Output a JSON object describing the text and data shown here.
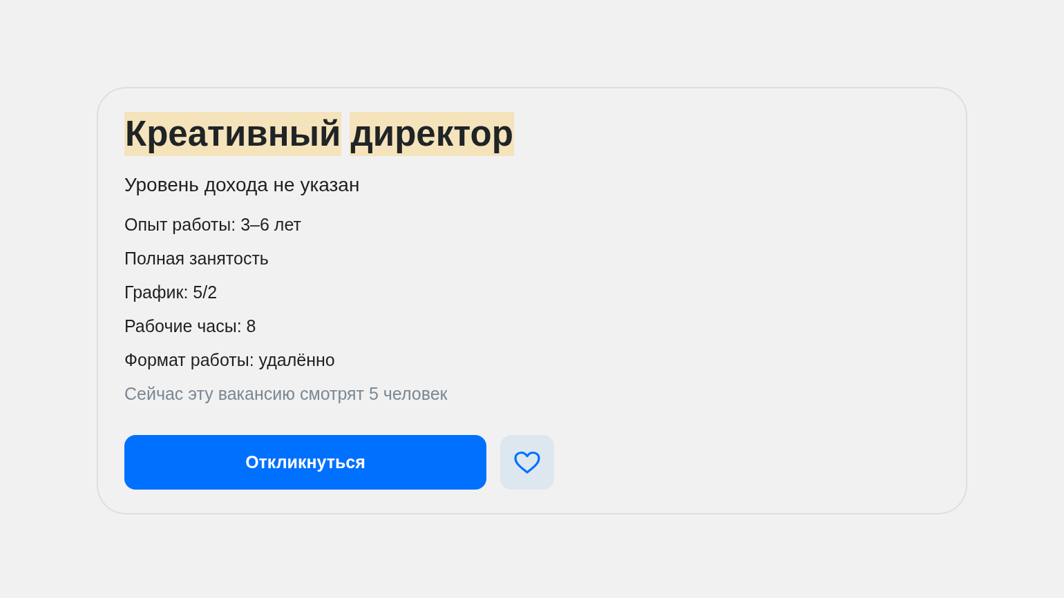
{
  "vacancy": {
    "title_words": [
      {
        "text": "Креативный",
        "highlighted": true
      },
      {
        "text": "директор",
        "highlighted": true
      }
    ],
    "salary": "Уровень дохода не указан",
    "details": [
      "Опыт работы: 3–6 лет",
      "Полная занятость",
      "График: 5/2",
      "Рабочие часы: 8",
      "Формат работы: удалённо"
    ],
    "viewers": "Сейчас эту вакансию смотрят 5 человек",
    "apply_button": "Откликнуться",
    "favorite": {
      "selected": false
    }
  }
}
